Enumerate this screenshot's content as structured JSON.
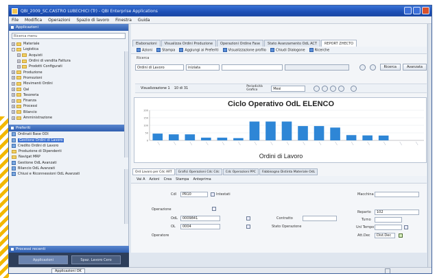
{
  "window": {
    "title": "QBI_2009_SC.CASTRO LUBECHICI (Tr) - QBI Enterprise Applications"
  },
  "menu": [
    "File",
    "Modifica",
    "Operazioni",
    "Spazio di lavoro",
    "Finestra",
    "Guida"
  ],
  "left_panel": {
    "header": "Applicazioni",
    "search_placeholder": "Ricerca menu",
    "tree": [
      {
        "label": "Materiale",
        "type": "folder",
        "indent": 0,
        "expanded": false
      },
      {
        "label": "Logistica",
        "type": "folder",
        "indent": 0,
        "expanded": true
      },
      {
        "label": "Acquisti",
        "type": "folder",
        "indent": 1,
        "expanded": false
      },
      {
        "label": "Ordini di vendita Fattura",
        "type": "folder",
        "indent": 1,
        "expanded": false
      },
      {
        "label": "Prodotti Configurati",
        "type": "folder",
        "indent": 1,
        "expanded": false
      },
      {
        "label": "Produzione",
        "type": "folder",
        "indent": 0,
        "expanded": false
      },
      {
        "label": "Promozioni",
        "type": "folder",
        "indent": 0,
        "expanded": false
      },
      {
        "label": "Movimenti Ordini",
        "type": "folder",
        "indent": 0,
        "expanded": false
      },
      {
        "label": "Qal",
        "type": "folder",
        "indent": 0,
        "expanded": false
      },
      {
        "label": "Tesoreria",
        "type": "folder",
        "indent": 0,
        "expanded": false
      },
      {
        "label": "Finanza",
        "type": "folder",
        "indent": 0,
        "expanded": false
      },
      {
        "label": "Processi",
        "type": "folder",
        "indent": 0,
        "expanded": false
      },
      {
        "label": "Bilancio",
        "type": "folder",
        "indent": 0,
        "expanded": false
      },
      {
        "label": "Amministrazione",
        "type": "folder",
        "indent": 0,
        "expanded": false
      }
    ],
    "preferiti_header": "Preferiti",
    "preferiti": [
      {
        "label": "Ordinati Base ODI",
        "type": "doc",
        "selected": false
      },
      {
        "label": "Gestione Ordini di Lavoro",
        "type": "doc",
        "selected": true
      },
      {
        "label": "Credito Ordini di Lavoro",
        "type": "doc",
        "selected": false
      },
      {
        "label": "Produzione di Dipendenti",
        "type": "folder",
        "selected": false
      },
      {
        "label": "Navigat MRP",
        "type": "folder",
        "selected": false
      },
      {
        "label": "Gestione OdL Avanzati",
        "type": "doc",
        "selected": false
      },
      {
        "label": "Bilancio OdL Avanzati",
        "type": "doc",
        "selected": false
      },
      {
        "label": "Chiusi e Riconnessioni OdL Avanzati",
        "type": "doc",
        "selected": false
      }
    ],
    "recent_header": "Processi recenti",
    "bottom_tabs": [
      "Applicazioni",
      "Spaz. Lavoro Cero"
    ]
  },
  "status": {
    "center": "Applicazioni OK"
  },
  "tabs": [
    {
      "label": "Elaborazioni",
      "active": false
    },
    {
      "label": "Visualizza Ordini Produzione",
      "active": false
    },
    {
      "label": "Operazioni Ordine Fase",
      "active": false
    },
    {
      "label": "Stato Avanzamento OdL ACT",
      "active": false
    },
    {
      "label": "REPORT ZHECTO",
      "active": true
    }
  ],
  "toolbar1": [
    "Azioni",
    "Stampa",
    "Aggiungi ai Preferiti",
    "Visualizzazione profilo",
    "Chiudi Dialogone",
    "Ricerche"
  ],
  "ricerca_label": "Ricerca",
  "filters": {
    "field": "Ordini di Lavoro",
    "operator": "iniziata",
    "value": "",
    "search_btn": "Ricerca",
    "adv_btn": "Avanzata"
  },
  "row2": {
    "label": "Visualizzazione 1",
    "value": "10 di 31",
    "periodo_label": "Periodicità Grafico",
    "periodo_value": "Mesi"
  },
  "chart_data": {
    "type": "bar",
    "title": "Ciclo Operativo OdL  ELENCO",
    "xlabel": "Ordini di Lavoro",
    "ylabel": "",
    "series": [
      {
        "name": "Ore",
        "values": [
          45,
          40,
          40,
          18,
          18,
          15,
          125,
          125,
          125,
          95,
          95,
          85,
          35,
          33,
          32,
          0,
          0
        ]
      }
    ],
    "ylim": [
      0,
      200
    ],
    "yticks": [
      "200",
      "150",
      "100",
      "50",
      "0"
    ],
    "color": "#2e86d6"
  },
  "lower_tabs": [
    {
      "label": "Ord Lavoro per Cdc ART",
      "active": true
    },
    {
      "label": "Grafici Operazioni Cdc Cdc",
      "active": false
    },
    {
      "label": "Cdc Operazioni PPC",
      "active": false
    },
    {
      "label": "Fabbisogno Distinta Materiale OdL",
      "active": false
    }
  ],
  "toolbar2": [
    "Vai A",
    "Azioni",
    "Crea",
    "Stampa",
    "Anteprima"
  ],
  "form": {
    "cdl_label": "Cdl",
    "cdl_value": "PR10",
    "cdl_desc": "Intestati",
    "operazione_label": "Operazione",
    "odl_label": "OdL",
    "odl_value": "0009841",
    "ol_label": "OL",
    "ol_value": "0004",
    "operatore_label": "Operatore",
    "contratto_label": "Contratto",
    "stato_label": "Stato Operazione",
    "macchina_label": "Macchina",
    "reparto_label": "Reparto",
    "reparto_value": "102",
    "turno_label": "Turno",
    "unita_label": "Unl Tempo",
    "attivita_label": "Att.Dec",
    "attivita_value": "Dist.Dec"
  }
}
